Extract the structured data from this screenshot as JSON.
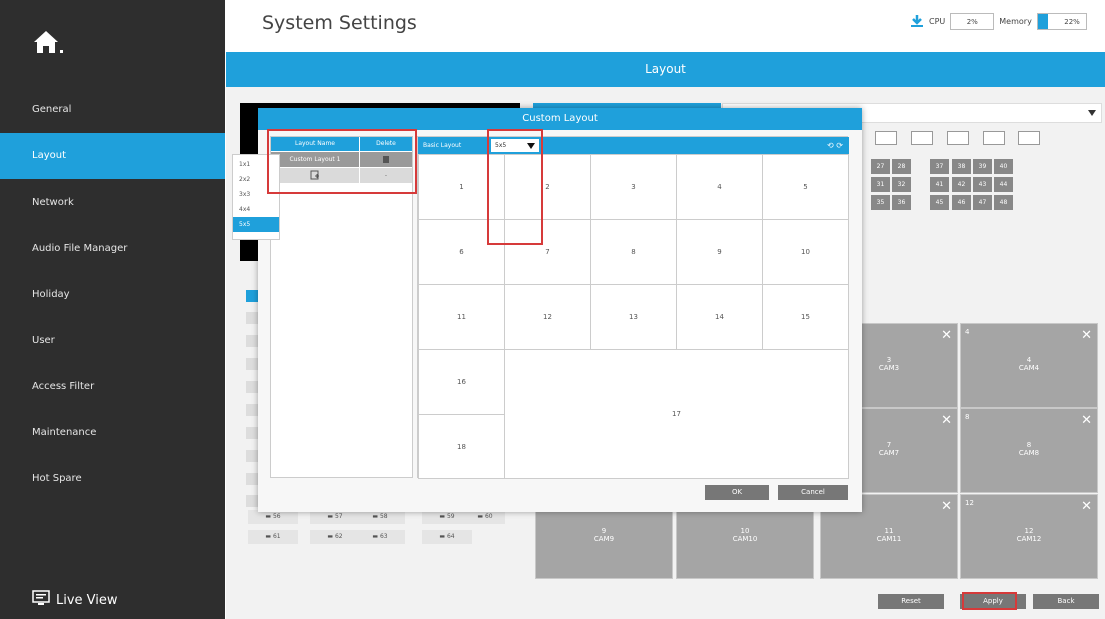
{
  "header": {
    "title": "System Settings",
    "cpu_label": "CPU",
    "cpu_value": "2%",
    "memory_label": "Memory",
    "memory_value": "22%",
    "memory_level": 0.22
  },
  "tab_title": "Layout",
  "sidebar": {
    "items": [
      {
        "label": "General",
        "active": false
      },
      {
        "label": "Layout",
        "active": true
      },
      {
        "label": "Network",
        "active": false
      },
      {
        "label": "Audio File Manager",
        "active": false
      },
      {
        "label": "Holiday",
        "active": false
      },
      {
        "label": "User",
        "active": false
      },
      {
        "label": "Access Filter",
        "active": false
      },
      {
        "label": "Maintenance",
        "active": false
      },
      {
        "label": "Hot Spare",
        "active": false
      }
    ],
    "live_view": "Live View"
  },
  "background": {
    "channel_numbers": [
      "27",
      "28",
      "37",
      "38",
      "39",
      "40",
      "31",
      "32",
      "41",
      "42",
      "43",
      "44",
      "35",
      "36",
      "45",
      "46",
      "47",
      "48"
    ],
    "channel_chips": [
      "56",
      "57",
      "58",
      "59",
      "60",
      "61",
      "62",
      "63",
      "64"
    ],
    "cells": [
      {
        "num": "3",
        "cam": "CAM3",
        "tl": ""
      },
      {
        "num": "4",
        "cam": "CAM4",
        "tl": "4"
      },
      {
        "num": "7",
        "cam": "CAM7",
        "tl": ""
      },
      {
        "num": "8",
        "cam": "CAM8",
        "tl": "8"
      },
      {
        "num": "9",
        "cam": "CAM9",
        "tl": ""
      },
      {
        "num": "10",
        "cam": "CAM10",
        "tl": ""
      },
      {
        "num": "11",
        "cam": "CAM11",
        "tl": ""
      },
      {
        "num": "12",
        "cam": "CAM12",
        "tl": "12"
      }
    ],
    "buttons": {
      "reset": "Reset",
      "apply": "Apply",
      "back": "Back"
    }
  },
  "dialog": {
    "title": "Custom Layout",
    "list_headers": {
      "name": "Layout Name",
      "delete": "Delete"
    },
    "layouts": [
      {
        "name": "Custom Layout 1"
      }
    ],
    "add_row_value": "-",
    "basic_layout_label": "Basic Layout",
    "selected_layout": "5x5",
    "options": [
      "1x1",
      "2x2",
      "3x3",
      "4x4",
      "5x5"
    ],
    "cells": [
      "1",
      "2",
      "3",
      "4",
      "5",
      "6",
      "7",
      "8",
      "9",
      "10",
      "11",
      "12",
      "13",
      "14",
      "15",
      "16",
      "17",
      "18"
    ],
    "ok": "OK",
    "cancel": "Cancel"
  },
  "colors": {
    "accent": "#1fa0db",
    "sidebar": "#2e2e2e",
    "highlight": "#d63a3a"
  }
}
